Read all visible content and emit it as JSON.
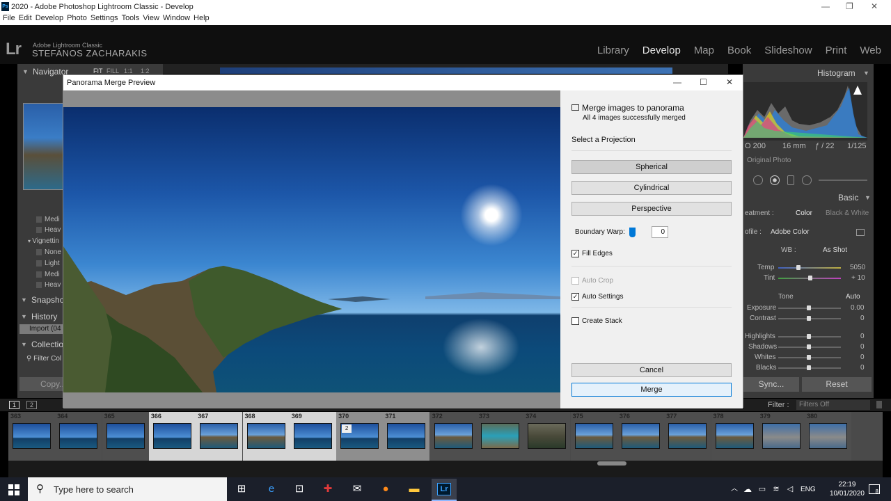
{
  "window": {
    "title": "2020 - Adobe Photoshop Lightroom Classic - Develop",
    "icon": "Ps",
    "controls": [
      "—",
      "❐",
      "✕"
    ]
  },
  "menu": [
    "File",
    "Edit",
    "Develop",
    "Photo",
    "Settings",
    "Tools",
    "View",
    "Window",
    "Help"
  ],
  "identity": {
    "logo": "Lr",
    "app": "Adobe Lightroom Classic",
    "user": "STEFANOS ZACHARAKIS"
  },
  "modules": [
    {
      "label": "Library",
      "active": false
    },
    {
      "label": "Develop",
      "active": true
    },
    {
      "label": "Map",
      "active": false
    },
    {
      "label": "Book",
      "active": false
    },
    {
      "label": "Slideshow",
      "active": false
    },
    {
      "label": "Print",
      "active": false
    },
    {
      "label": "Web",
      "active": false
    }
  ],
  "left_panel": {
    "navigator": {
      "title": "Navigator",
      "zoom_opts": [
        "FIT",
        "FILL",
        "1:1",
        "1:2"
      ]
    },
    "tree": [
      "Medi",
      "Heav",
      "Vignettin",
      "None",
      "Light",
      "Medi",
      "Heav"
    ],
    "snapshots": "Snapshc",
    "history": "History",
    "history_item": "Import (04",
    "collections": "Collectio",
    "filter": "Filter Col",
    "copy_label": "Copy..."
  },
  "right_panel": {
    "histogram_title": "Histogram",
    "exif": {
      "iso": "O 200",
      "focal": "16 mm",
      "aperture": "ƒ / 22",
      "shutter": "1/125"
    },
    "original_photo": "Original Photo",
    "basic_title": "Basic",
    "treatment_label": "eatment :",
    "treatment_color": "Color",
    "treatment_bw": "Black & White",
    "profile_label": "ofile :",
    "profile_value": "Adobe Color",
    "wb_label": "WB :",
    "wb_value": "As Shot",
    "temp": {
      "label": "Temp",
      "value": "5050"
    },
    "tint": {
      "label": "Tint",
      "value": "+ 10"
    },
    "tone_label": "Tone",
    "tone_auto": "Auto",
    "sliders": [
      {
        "label": "Exposure",
        "value": "0.00"
      },
      {
        "label": "Contrast",
        "value": "0"
      },
      {
        "label": "Highlights",
        "value": "0"
      },
      {
        "label": "Shadows",
        "value": "0"
      },
      {
        "label": "Whites",
        "value": "0"
      },
      {
        "label": "Blacks",
        "value": "0"
      }
    ],
    "sync_label": "Sync...",
    "reset_label": "Reset"
  },
  "filmbar": {
    "page1": "1",
    "page2": "2",
    "filter_label": "Filter :",
    "filter_value": "Filters Off"
  },
  "filmstrip": [
    {
      "num": "363",
      "state": "normal",
      "tone": "sky"
    },
    {
      "num": "364",
      "state": "normal",
      "tone": "sky"
    },
    {
      "num": "365",
      "state": "normal",
      "tone": "sky"
    },
    {
      "num": "366",
      "state": "selected",
      "tone": "sky"
    },
    {
      "num": "367",
      "state": "selected",
      "tone": "coast"
    },
    {
      "num": "368",
      "state": "selected",
      "tone": "coast"
    },
    {
      "num": "369",
      "state": "selected",
      "tone": "sky"
    },
    {
      "num": "370",
      "state": "group",
      "tone": "sky",
      "badge": "2"
    },
    {
      "num": "371",
      "state": "group",
      "tone": "sky"
    },
    {
      "num": "372",
      "state": "normal",
      "tone": "coast"
    },
    {
      "num": "373",
      "state": "normal",
      "tone": "bay"
    },
    {
      "num": "374",
      "state": "normal",
      "tone": "rock"
    },
    {
      "num": "375",
      "state": "normal",
      "tone": "coast"
    },
    {
      "num": "376",
      "state": "normal",
      "tone": "coast"
    },
    {
      "num": "377",
      "state": "normal",
      "tone": "coast"
    },
    {
      "num": "378",
      "state": "normal",
      "tone": "coast"
    },
    {
      "num": "379",
      "state": "normal",
      "tone": "town"
    },
    {
      "num": "380",
      "state": "normal",
      "tone": "town"
    }
  ],
  "dialog": {
    "title": "Panorama Merge Preview",
    "heading": "Merge images to panorama",
    "status": "All 4 images successfully merged",
    "projection_label": "Select a Projection",
    "projections": [
      {
        "label": "Spherical",
        "selected": true
      },
      {
        "label": "Cylindrical",
        "selected": false
      },
      {
        "label": "Perspective",
        "selected": false
      }
    ],
    "boundary_warp_label": "Boundary Warp:",
    "boundary_warp_value": "0",
    "fill_edges": {
      "label": "Fill Edges",
      "checked": true
    },
    "auto_crop": {
      "label": "Auto Crop",
      "checked": false,
      "disabled": true
    },
    "auto_settings": {
      "label": "Auto Settings",
      "checked": true
    },
    "create_stack": {
      "label": "Create Stack",
      "checked": false
    },
    "cancel_label": "Cancel",
    "merge_label": "Merge"
  },
  "taskbar": {
    "search_placeholder": "Type here to search",
    "lang": "ENG",
    "time": "22:19",
    "date": "10/01/2020",
    "notif_count": "8"
  }
}
